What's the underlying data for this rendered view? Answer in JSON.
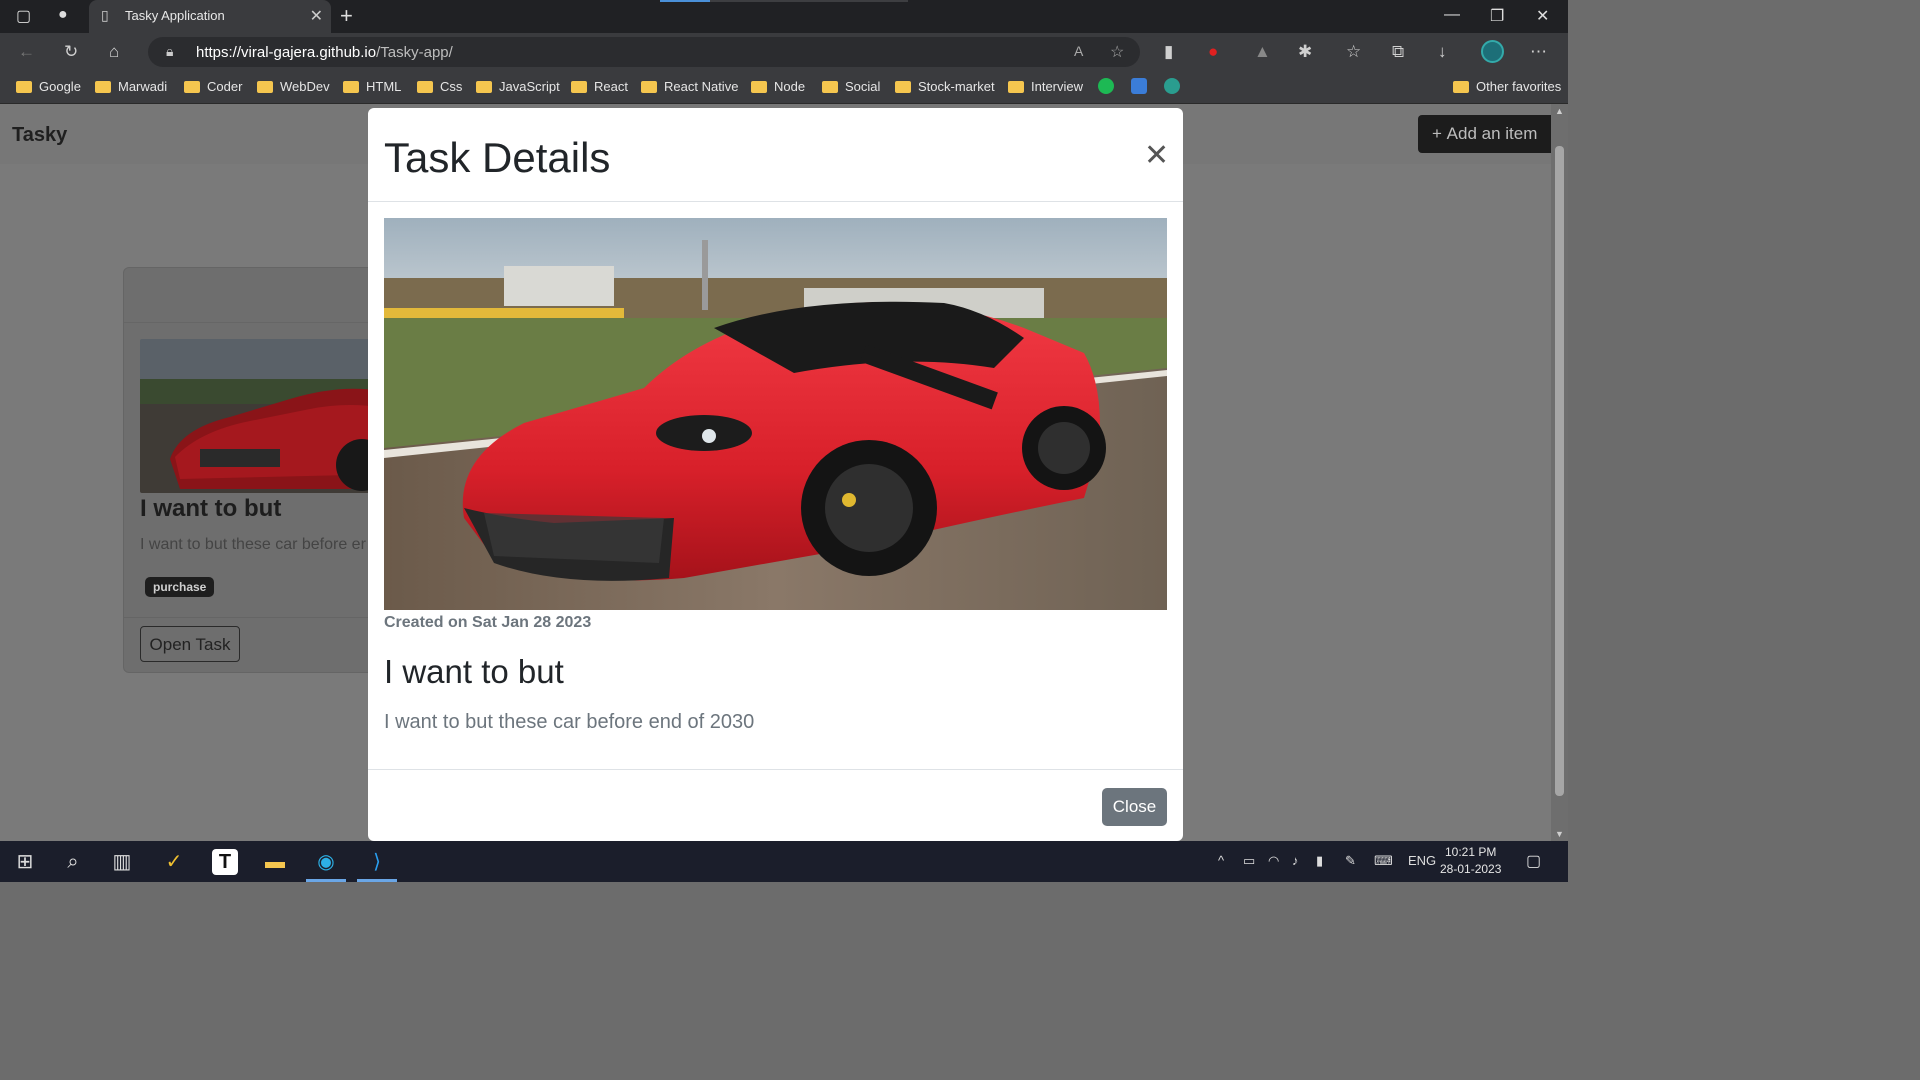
{
  "browser": {
    "tab_title": "Tasky Application",
    "url_host": "https://viral-gajera.github.io",
    "url_path": "/Tasky-app/",
    "bookmarks": [
      "Google",
      "Marwadi",
      "Coder",
      "WebDev",
      "HTML",
      "Css",
      "JavaScript",
      "React",
      "React Native",
      "Node",
      "Social",
      "Stock-market",
      "Interview"
    ],
    "other_favorites": "Other favorites"
  },
  "app": {
    "brand": "Tasky",
    "add_button": "Add an item",
    "card": {
      "title": "I want to but",
      "text": "I want to but these car before er",
      "tag": "purchase",
      "open_button": "Open Task"
    }
  },
  "modal": {
    "title": "Task Details",
    "created": "Created on Sat Jan 28 2023",
    "task_title": "I want to but",
    "task_desc": "I want to but these car before end of 2030",
    "close_button": "Close"
  },
  "taskbar": {
    "lang": "ENG",
    "time": "10:21 PM",
    "date": "28-01-2023"
  },
  "colors": {
    "car_red": "#d8202a",
    "modal_button": "#6c757d",
    "taskbar": "#1b1e2b"
  }
}
